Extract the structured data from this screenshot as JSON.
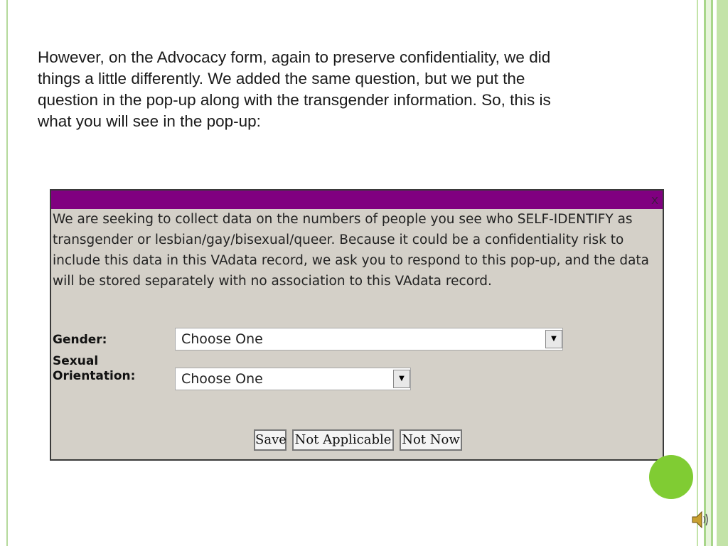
{
  "slide": {
    "body_text": "However, on the Advocacy form, again to preserve confidentiality, we did things a little differently.  We added the same question, but we put the question in the pop-up along with the transgender information.  So, this is what you will see in the pop-up:"
  },
  "dialog": {
    "close_glyph": "X",
    "message": "We are seeking to collect data on the numbers of people you see who SELF-IDENTIFY as transgender or lesbian/gay/bisexual/queer. Because it could be a confidentiality risk to include this data in this VAdata record, we ask you to respond to this pop-up, and the data will be stored separately with no association to this VAdata record.",
    "gender": {
      "label": "Gender:",
      "value": "Choose One"
    },
    "orientation": {
      "label": "Sexual Orientation:",
      "value": "Choose One"
    },
    "buttons": {
      "save": "Save",
      "not_applicable": "Not Applicable",
      "not_now": "Not Now"
    }
  },
  "icons": {
    "dropdown": "chevron-down-icon",
    "close": "close-icon",
    "speaker": "speaker-icon"
  },
  "colors": {
    "titlebar": "#800080",
    "dialog_bg": "#d4d0c8",
    "accent_green": "#80cc33",
    "frame_green": "#a8d68a"
  }
}
